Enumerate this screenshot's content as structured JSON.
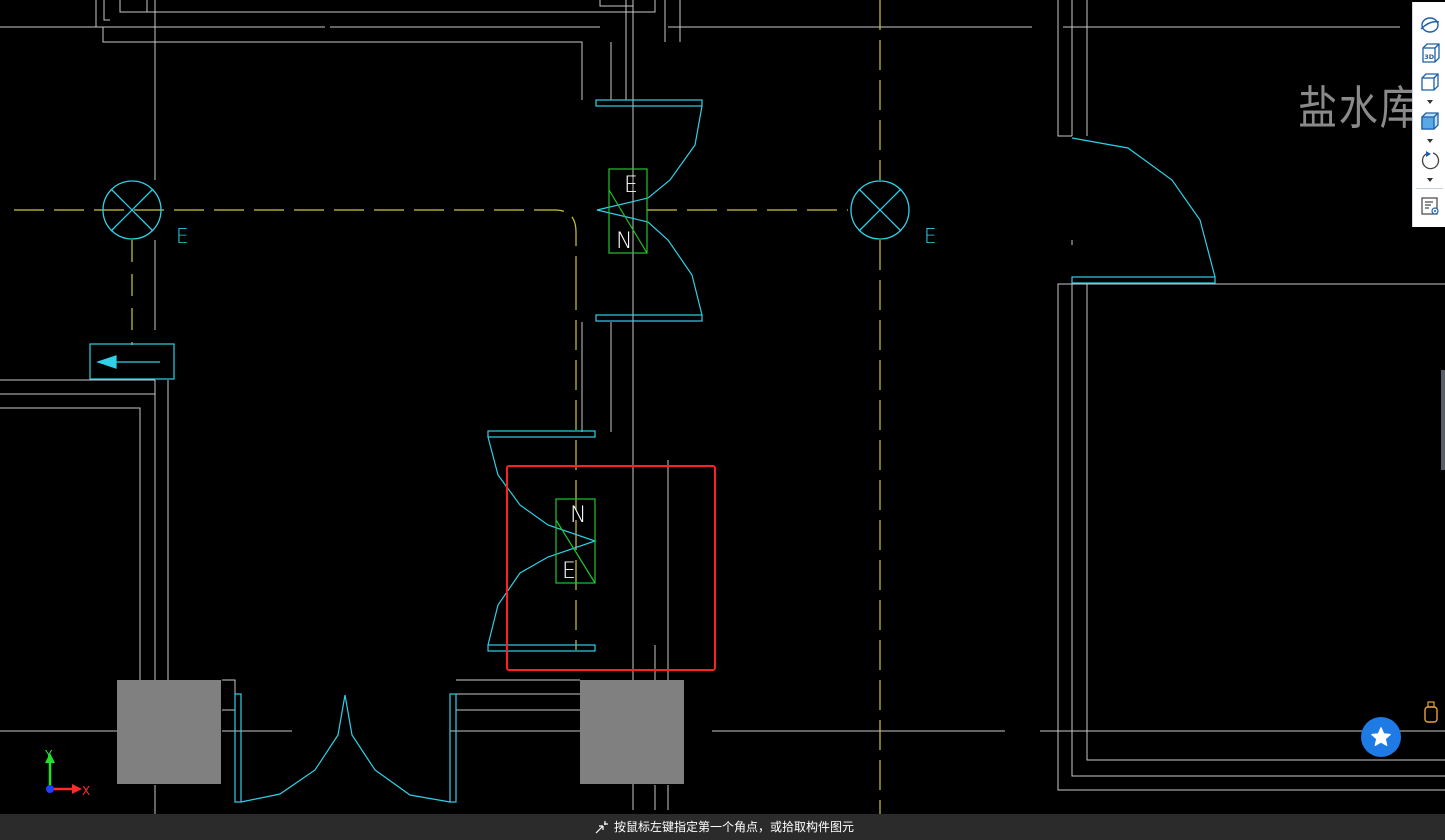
{
  "drawing": {
    "room_label": "盐水库房",
    "fixture_tag_left": "E",
    "fixture_tag_right": "E",
    "door_top": {
      "letter_top": "E",
      "letter_bottom": "N"
    },
    "door_bottom": {
      "letter_top": "N",
      "letter_bottom": "E"
    }
  },
  "ucs": {
    "y_label": "Y",
    "x_label": "X"
  },
  "toolbar": {
    "items": [
      {
        "name": "orbit-icon"
      },
      {
        "name": "3d-view-icon",
        "label": "3D"
      },
      {
        "name": "view-cube-icon"
      },
      {
        "name": "shaded-view-icon"
      },
      {
        "name": "rotate-icon"
      },
      {
        "name": "view-list-icon"
      }
    ]
  },
  "status": {
    "prompt": "按鼠标左键指定第一个角点，或拾取构件图元"
  },
  "colors": {
    "background": "#000000",
    "wall_line": "#c8c8c8",
    "axis_line": "#cfc73a",
    "door_line": "#2fd0e8",
    "fixture_green": "#22c32e",
    "selection_red": "#ff2020",
    "column_fill": "#808080",
    "status_bar": "#2b2b2b",
    "fav_button": "#1e7be6"
  }
}
